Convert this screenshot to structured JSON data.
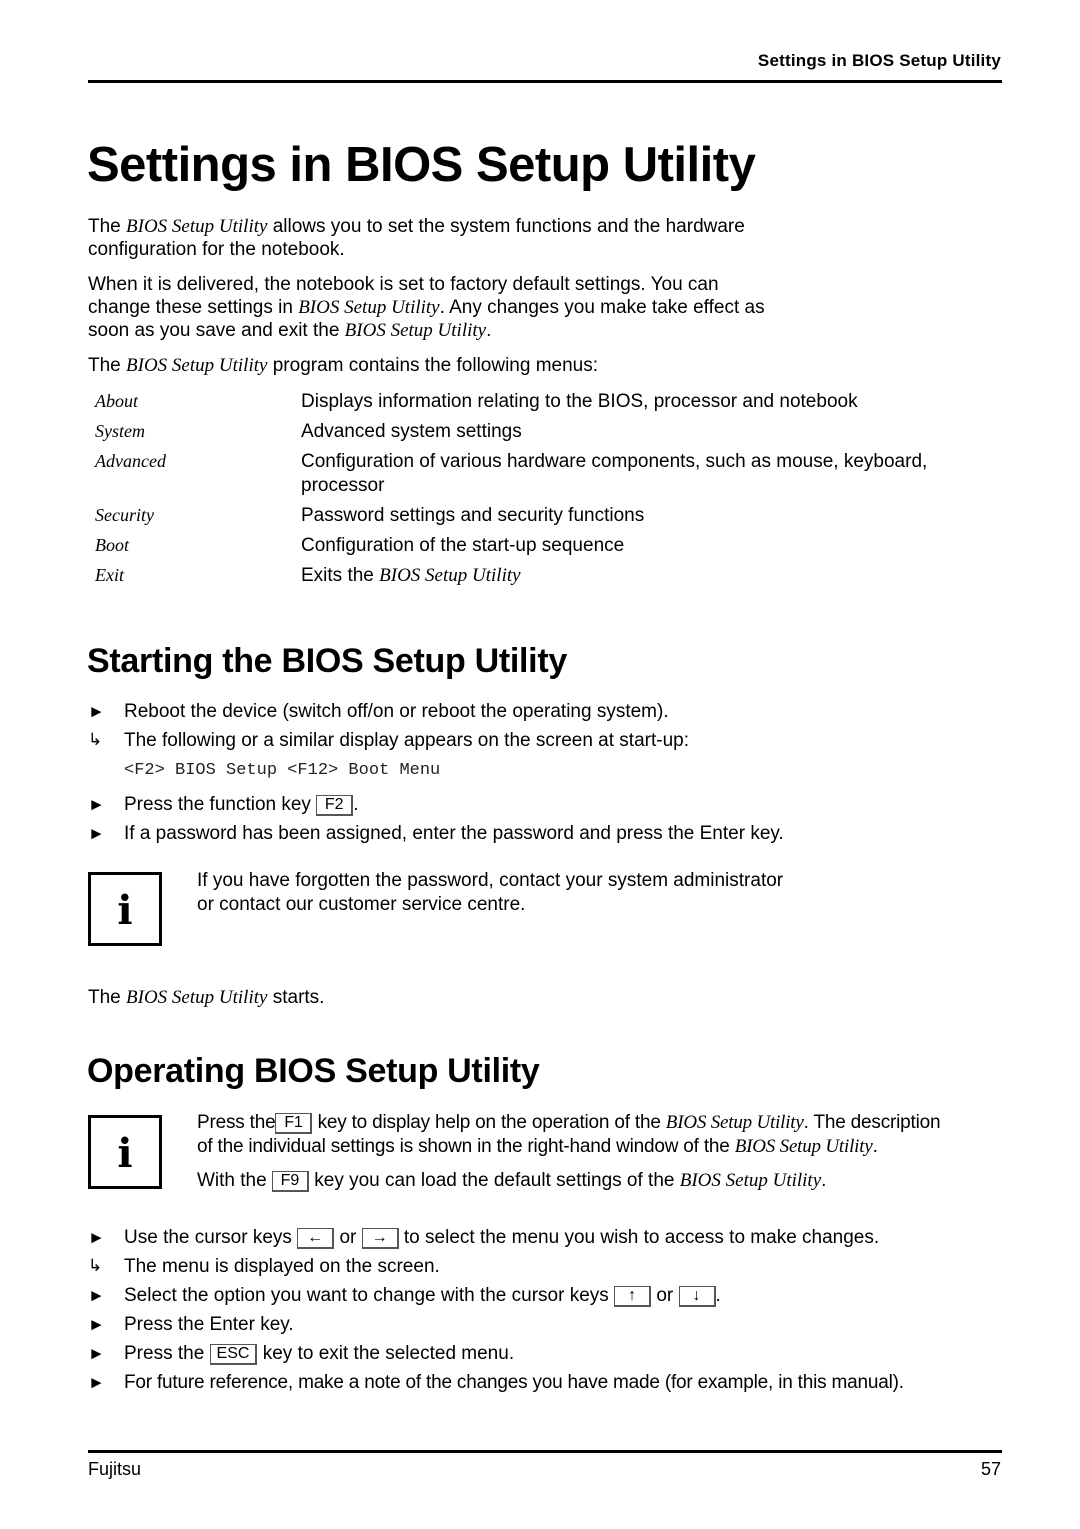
{
  "header": {
    "running_title": "Settings in BIOS Setup Utility"
  },
  "page_title": "Settings in BIOS Setup Utility",
  "intro": {
    "p1_pre": "The ",
    "p1_it": "BIOS Setup Utility",
    "p1_post": " allows you to set the system functions and the hardware",
    "p1_line2": "configuration for the notebook.",
    "p2_line1": "When it is delivered, the notebook is set to factory default settings.  You can",
    "p2_line2_pre": "change these settings in ",
    "p2_line2_it": "BIOS Setup Utility",
    "p2_line2_post": ". Any changes you make take effect as",
    "p2_line3_pre": "soon as you save and exit the ",
    "p2_line3_it": "BIOS Setup Utility",
    "p2_line3_post": ".",
    "p3_pre": "The ",
    "p3_it": "BIOS Setup Utility",
    "p3_post": " program contains the following menus:"
  },
  "menus": [
    {
      "name": "About",
      "desc": "Displays information relating to the BIOS, processor and notebook"
    },
    {
      "name": "System",
      "desc": "Advanced system settings"
    },
    {
      "name": "Advanced",
      "desc": "Configuration of various hardware components, such as mouse, keyboard,",
      "desc2": "processor"
    },
    {
      "name": "Security",
      "desc": "Password settings and security functions"
    },
    {
      "name": "Boot",
      "desc": "Configuration of the start-up sequence"
    },
    {
      "name": "Exit",
      "desc_pre": "Exits the ",
      "desc_it": "BIOS Setup Utility"
    }
  ],
  "starting": {
    "title": "Starting the BIOS Setup Utility",
    "step1": "Reboot the device (switch off/on or reboot the operating system).",
    "result1": "The following or a similar display appears on the screen at start-up:",
    "screen_text": "<F2> BIOS Setup <F12> Boot Menu",
    "step2_pre": "Press the function key ",
    "step2_key": "F2",
    "step2_post": ".",
    "step3": "If a password has been assigned, enter the password and press the Enter key.",
    "note_line1": "If you have forgotten the password, contact your system administrator",
    "note_line2": "or contact our customer service centre.",
    "starts_pre": "The ",
    "starts_it": "BIOS Setup Utility",
    "starts_post": " starts."
  },
  "operating": {
    "title": "Operating BIOS Setup Utility",
    "note1_pre": "Press the",
    "note1_key": "F1",
    "note1_mid": "key to display help on the operation of the ",
    "note1_it": "BIOS Setup Utility",
    "note1_post": ". The description",
    "note1_line2_pre": "of the individual settings is shown in the right-hand window of the ",
    "note1_line2_it": "BIOS Setup Utility",
    "note1_line2_post": ".",
    "note2_pre": "With the ",
    "note2_key": "F9",
    "note2_mid": " key you can load the default settings of the ",
    "note2_it": "BIOS Setup Utility",
    "note2_post": ".",
    "step1_pre": "Use the cursor keys ",
    "step1_key1": "←",
    "step1_mid": " or ",
    "step1_key2": "→",
    "step1_post": " to select the menu you wish to access to make changes.",
    "result1": "The menu is displayed on the screen.",
    "step2_pre": "Select the option you want to change with the cursor keys ",
    "step2_key1": "↑",
    "step2_mid": " or ",
    "step2_key2": "↓",
    "step2_post": ".",
    "step3": "Press the Enter key.",
    "step4_pre": "Press the ",
    "step4_key": "ESC",
    "step4_post": " key to exit the selected menu.",
    "step5": "For future reference, make a note of the changes you have made (for example, in this manual)."
  },
  "icons": {
    "bullet": "►",
    "result": "↳",
    "info": "i"
  },
  "footer": {
    "brand": "Fujitsu",
    "page_number": "57"
  }
}
